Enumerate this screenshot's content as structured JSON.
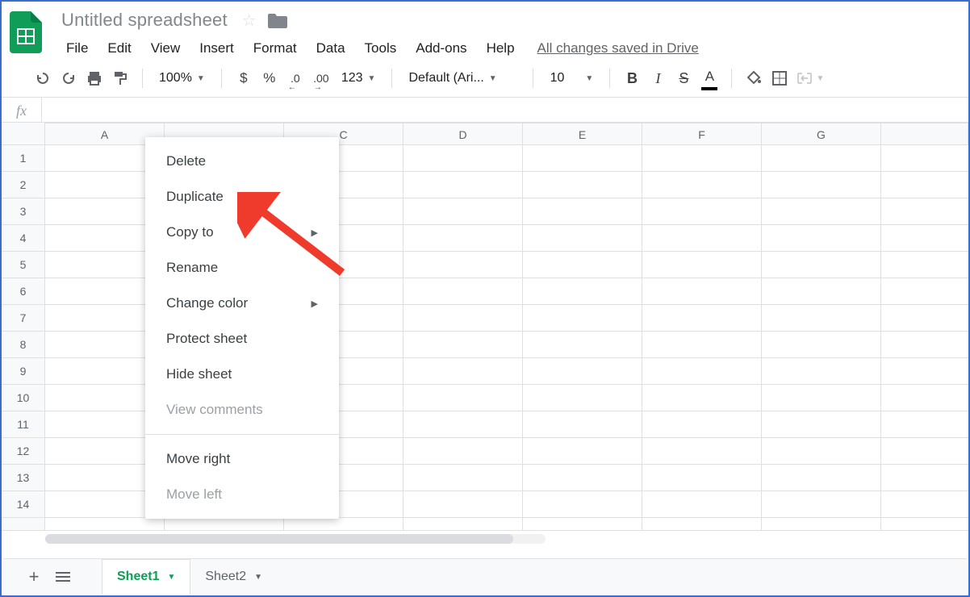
{
  "header": {
    "title": "Untitled spreadsheet",
    "save_status": "All changes saved in Drive"
  },
  "menu": {
    "items": [
      "File",
      "Edit",
      "View",
      "Insert",
      "Format",
      "Data",
      "Tools",
      "Add-ons",
      "Help"
    ]
  },
  "toolbar": {
    "zoom": "100%",
    "currency": "$",
    "percent": "%",
    "dec_less": ".0",
    "dec_more": ".00",
    "num_format": "123",
    "font": "Default (Ari...",
    "font_size": "10",
    "bold": "B",
    "italic": "I",
    "strike": "S",
    "text_color": "A"
  },
  "fx_label": "fx",
  "columns": [
    "A",
    "",
    "C",
    "D",
    "E",
    "F",
    "G"
  ],
  "rows": [
    "1",
    "2",
    "3",
    "4",
    "5",
    "6",
    "7",
    "8",
    "9",
    "10",
    "11",
    "12",
    "13",
    "14"
  ],
  "tabs": {
    "add_icon": "+",
    "all_icon": "≡",
    "sheet1": "Sheet1",
    "sheet2": "Sheet2"
  },
  "context_menu": {
    "delete": "Delete",
    "duplicate": "Duplicate",
    "copy_to": "Copy to",
    "rename": "Rename",
    "change_color": "Change color",
    "protect": "Protect sheet",
    "hide": "Hide sheet",
    "view_comments": "View comments",
    "move_right": "Move right",
    "move_left": "Move left"
  }
}
